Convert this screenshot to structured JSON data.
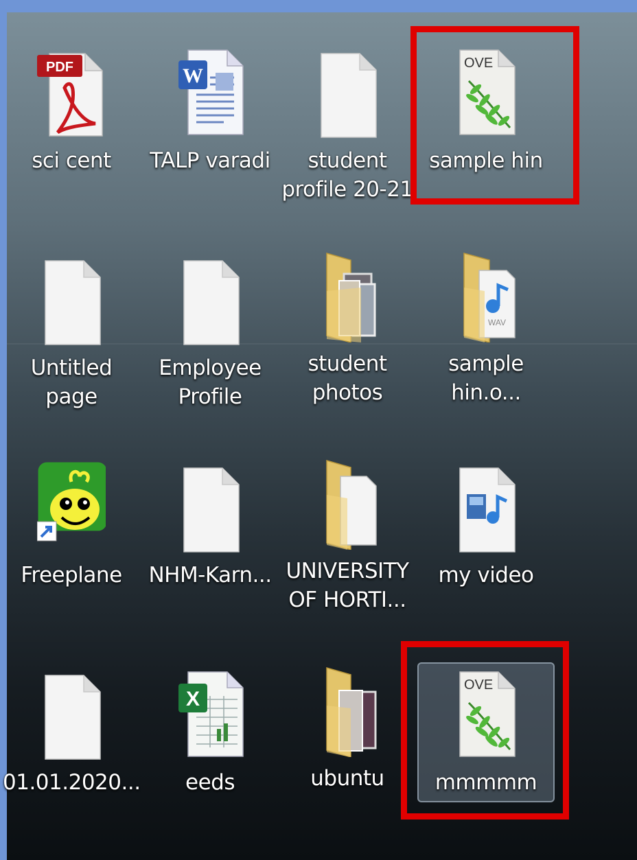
{
  "desktop": {
    "icons": [
      {
        "label": "sci cent",
        "icon": "pdf-file-icon"
      },
      {
        "label": "TALP varadi",
        "icon": "word-document-icon"
      },
      {
        "label": "student profile 20-21",
        "icon": "blank-file-icon"
      },
      {
        "label": "sample hin",
        "icon": "ove-file-icon"
      },
      {
        "label": "Untitled page",
        "icon": "blank-file-icon"
      },
      {
        "label": "Employee Profile",
        "icon": "blank-file-icon"
      },
      {
        "label": "student photos",
        "icon": "photo-folder-icon"
      },
      {
        "label": "sample hin.o...",
        "icon": "audio-folder-icon"
      },
      {
        "label": "Freeplane",
        "icon": "freeplane-shortcut-icon"
      },
      {
        "label": "NHM-Karn...",
        "icon": "blank-file-icon"
      },
      {
        "label": "UNIVERSITY OF HORTI...",
        "icon": "folder-icon"
      },
      {
        "label": "my video",
        "icon": "video-file-icon"
      },
      {
        "label": "01.01.2020...",
        "icon": "blank-file-icon"
      },
      {
        "label": "eeds",
        "icon": "excel-spreadsheet-icon"
      },
      {
        "label": "ubuntu",
        "icon": "image-folder-icon"
      },
      {
        "label": "mmmmm",
        "icon": "ove-file-icon"
      }
    ]
  },
  "colors": {
    "highlight": "#e00000",
    "label": "#ffffff"
  }
}
